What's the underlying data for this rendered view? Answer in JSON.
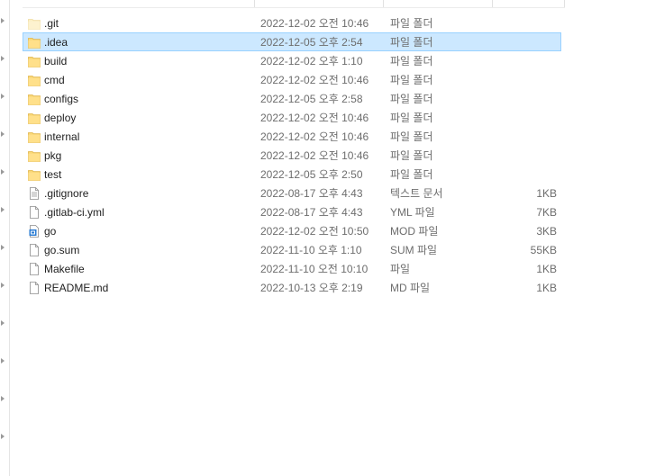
{
  "files": [
    {
      "name": ".git",
      "date": "2022-12-02 오전 10:46",
      "type": "파일 폴더",
      "size": "",
      "icon": "folder-icon-hidden",
      "selected": false
    },
    {
      "name": ".idea",
      "date": "2022-12-05 오후 2:54",
      "type": "파일 폴더",
      "size": "",
      "icon": "folder-icon",
      "selected": true
    },
    {
      "name": "build",
      "date": "2022-12-02 오후 1:10",
      "type": "파일 폴더",
      "size": "",
      "icon": "folder-icon",
      "selected": false
    },
    {
      "name": "cmd",
      "date": "2022-12-02 오전 10:46",
      "type": "파일 폴더",
      "size": "",
      "icon": "folder-icon",
      "selected": false
    },
    {
      "name": "configs",
      "date": "2022-12-05 오후 2:58",
      "type": "파일 폴더",
      "size": "",
      "icon": "folder-icon",
      "selected": false
    },
    {
      "name": "deploy",
      "date": "2022-12-02 오전 10:46",
      "type": "파일 폴더",
      "size": "",
      "icon": "folder-icon",
      "selected": false
    },
    {
      "name": "internal",
      "date": "2022-12-02 오전 10:46",
      "type": "파일 폴더",
      "size": "",
      "icon": "folder-icon",
      "selected": false
    },
    {
      "name": "pkg",
      "date": "2022-12-02 오전 10:46",
      "type": "파일 폴더",
      "size": "",
      "icon": "folder-icon",
      "selected": false
    },
    {
      "name": "test",
      "date": "2022-12-05 오후 2:50",
      "type": "파일 폴더",
      "size": "",
      "icon": "folder-icon",
      "selected": false
    },
    {
      "name": ".gitignore",
      "date": "2022-08-17 오후 4:43",
      "type": "텍스트 문서",
      "size": "1KB",
      "icon": "text-document-icon",
      "selected": false
    },
    {
      "name": ".gitlab-ci.yml",
      "date": "2022-08-17 오후 4:43",
      "type": "YML 파일",
      "size": "7KB",
      "icon": "file-icon",
      "selected": false
    },
    {
      "name": "go",
      "date": "2022-12-02 오전 10:50",
      "type": "MOD 파일",
      "size": "3KB",
      "icon": "mod-file-icon",
      "selected": false
    },
    {
      "name": "go.sum",
      "date": "2022-11-10 오후 1:10",
      "type": "SUM 파일",
      "size": "55KB",
      "icon": "file-icon",
      "selected": false
    },
    {
      "name": "Makefile",
      "date": "2022-11-10 오전 10:10",
      "type": "파일",
      "size": "1KB",
      "icon": "file-icon",
      "selected": false
    },
    {
      "name": "README.md",
      "date": "2022-10-13 오후 2:19",
      "type": "MD 파일",
      "size": "1KB",
      "icon": "file-icon",
      "selected": false
    }
  ]
}
